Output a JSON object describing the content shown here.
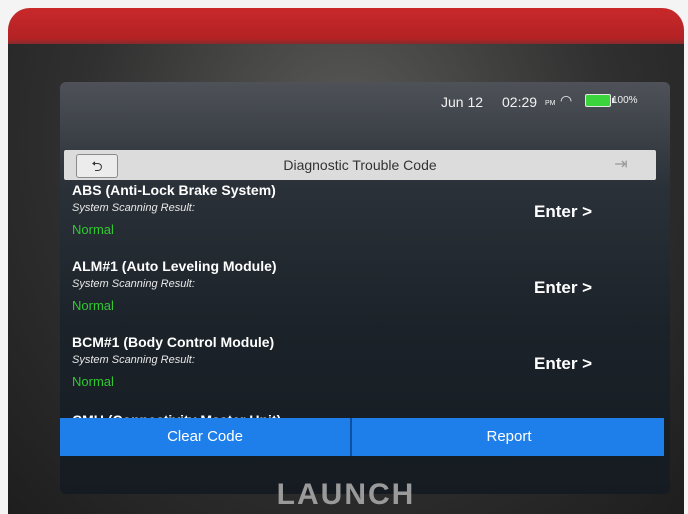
{
  "status": {
    "date": "Jun 12",
    "time": "02:29",
    "ampm": "PM",
    "battery_pct": "100%"
  },
  "header": {
    "back_symbol": "⮌",
    "title": "Diagnostic Trouble Code",
    "exit_symbol": "⇥"
  },
  "items": [
    {
      "name": "ABS (Anti-Lock Brake System)",
      "label": "System Scanning Result:",
      "result": "Normal",
      "action": "Enter >"
    },
    {
      "name": "ALM#1 (Auto Leveling Module)",
      "label": "System Scanning Result:",
      "result": "Normal",
      "action": "Enter >"
    },
    {
      "name": "BCM#1 (Body Control Module)",
      "label": "System Scanning Result:",
      "result": "Normal",
      "action": "Enter >"
    }
  ],
  "partial_item": {
    "name": "CMU (Connectivity Master Unit)"
  },
  "footer": {
    "clear_label": "Clear Code",
    "report_label": "Report"
  },
  "brand": "LAUNCH",
  "colors": {
    "device_red": "#c8292b",
    "accent_blue": "#1f7fea",
    "normal_green": "#31c831",
    "battery_green": "#3cd43c"
  },
  "icons": {
    "back": "back-arrow-icon",
    "exit": "exit-icon",
    "wifi": "wifi-icon",
    "battery": "battery-icon"
  }
}
